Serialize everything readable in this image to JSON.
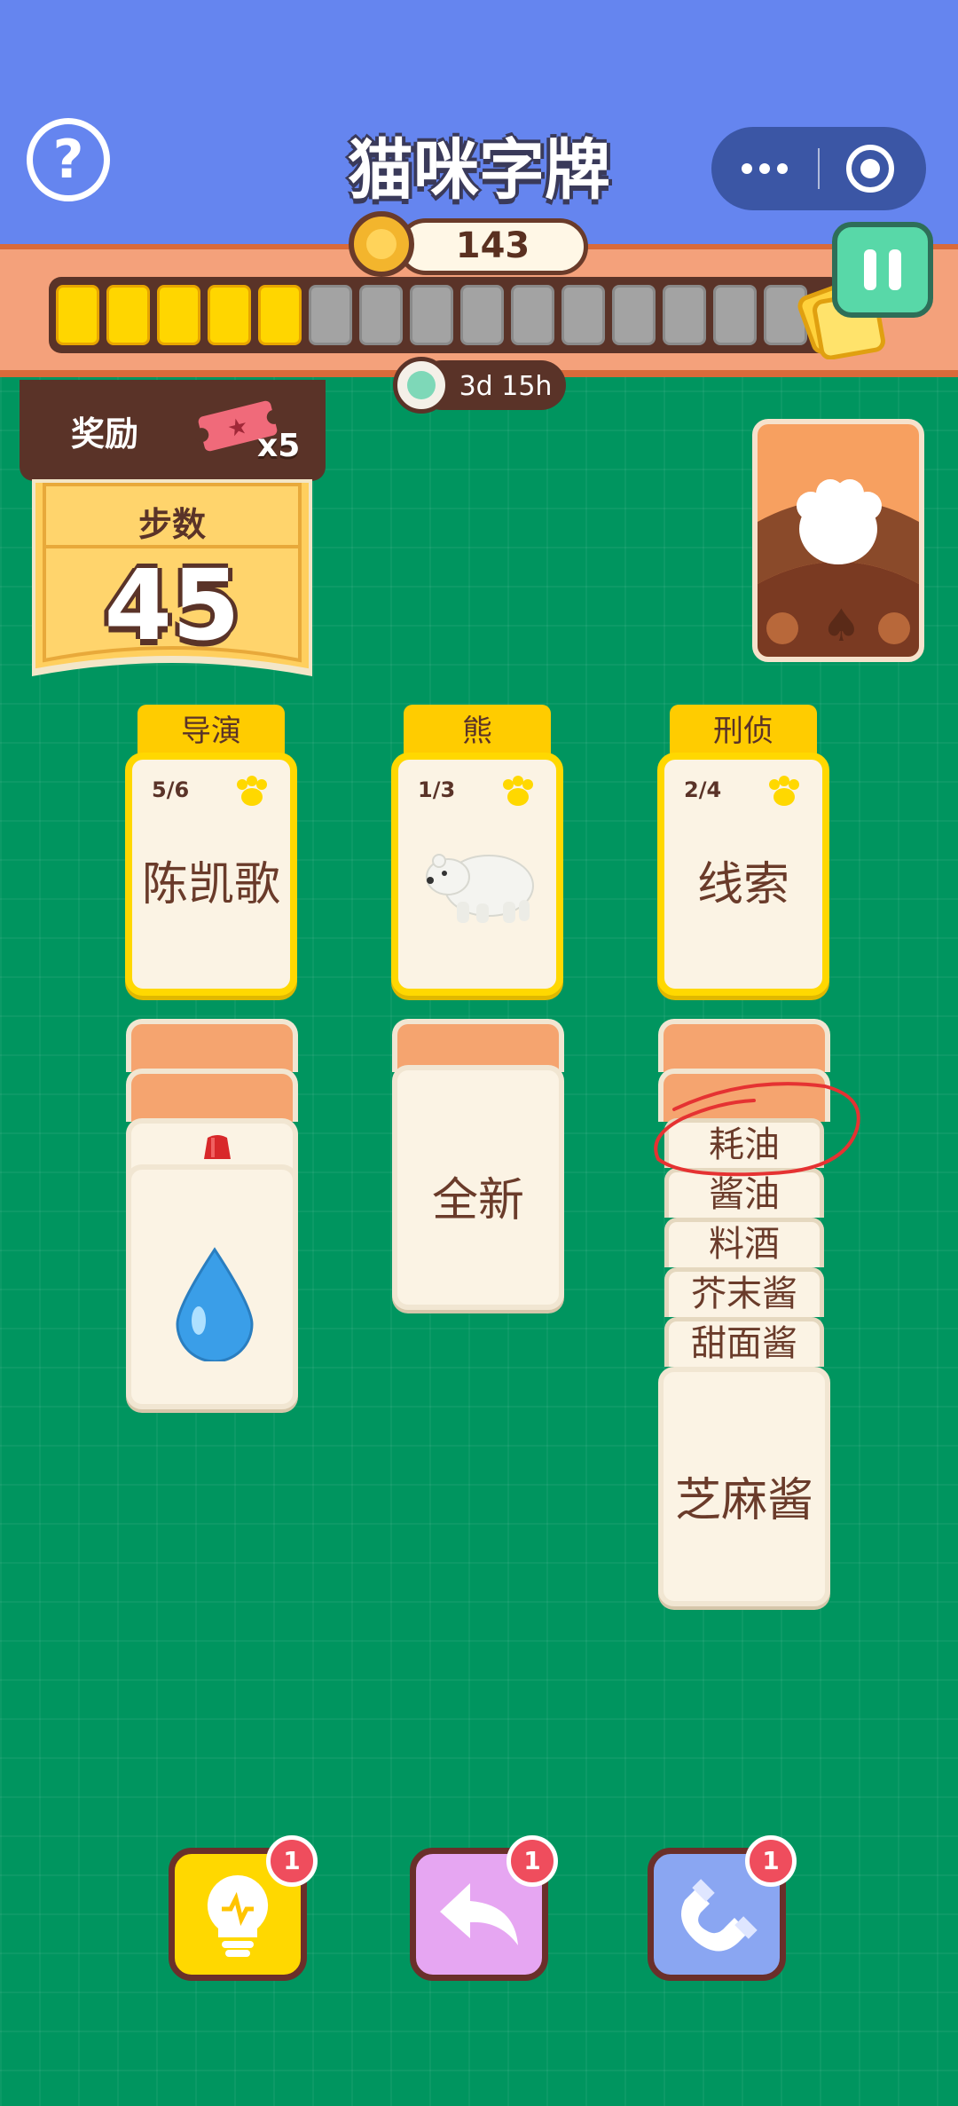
{
  "header": {
    "title": "猫咪字牌",
    "help_icon": "?"
  },
  "currency": {
    "coins": "143"
  },
  "progress": {
    "filled_segments": 5,
    "total_segments": 15
  },
  "timer": {
    "text": "3d 15h"
  },
  "reward": {
    "label": "奖励",
    "ticket_count": "x5"
  },
  "steps": {
    "label": "步数",
    "value": "45"
  },
  "foundations": [
    {
      "category": "导演",
      "count": "5/6",
      "card": "陈凯歌"
    },
    {
      "category": "熊",
      "count": "1/3",
      "card_icon": "polar-bear-icon"
    },
    {
      "category": "刑侦",
      "count": "2/4",
      "card": "线索"
    }
  ],
  "tableau": {
    "col1": {
      "top_card_icon": "water-drop-icon",
      "peek_icon": "jelly-icon"
    },
    "col2": {
      "card": "全新"
    },
    "col3": {
      "stack": [
        "耗油",
        "酱油",
        "料酒",
        "芥末酱",
        "甜面酱"
      ],
      "top_card": "芝麻酱"
    }
  },
  "boosters": [
    {
      "name": "hint",
      "icon": "lightbulb-icon",
      "count": "1",
      "color": "#ffd800"
    },
    {
      "name": "undo",
      "icon": "undo-arrow-icon",
      "count": "1",
      "color": "#e6a6f2"
    },
    {
      "name": "magnet",
      "icon": "magnet-icon",
      "count": "1",
      "color": "#8aa6f2"
    }
  ],
  "colors": {
    "background": "#00955f",
    "header": "#6585ef",
    "accent": "#ffd800"
  }
}
